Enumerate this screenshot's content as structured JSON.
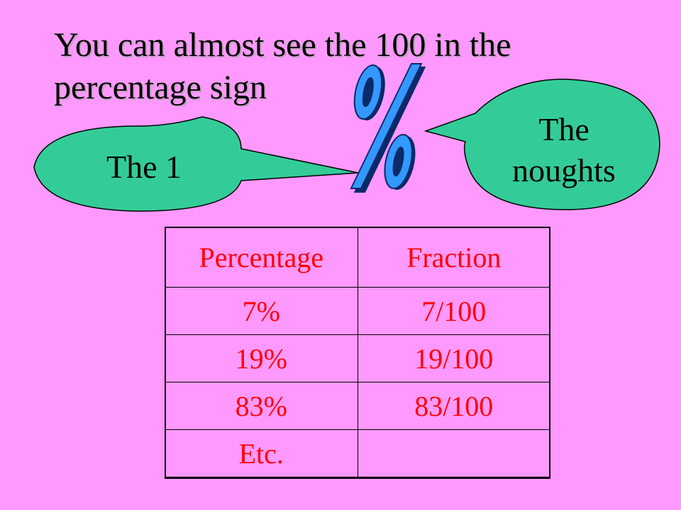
{
  "title": {
    "line1": "You can almost see the 100 in the",
    "line2": "percentage sign"
  },
  "callouts": {
    "left": "The 1",
    "right_line1": "The",
    "right_line2": "noughts"
  },
  "symbol": "%",
  "colors": {
    "background": "#ff99ff",
    "callout_fill": "#33cc99",
    "table_text": "#ff0000",
    "symbol_fill": "#3399ff"
  },
  "table": {
    "headers": [
      "Percentage",
      "Fraction"
    ],
    "rows": [
      [
        "7%",
        "7/100"
      ],
      [
        "19%",
        "19/100"
      ],
      [
        "83%",
        "83/100"
      ],
      [
        "Etc.",
        ""
      ]
    ]
  }
}
